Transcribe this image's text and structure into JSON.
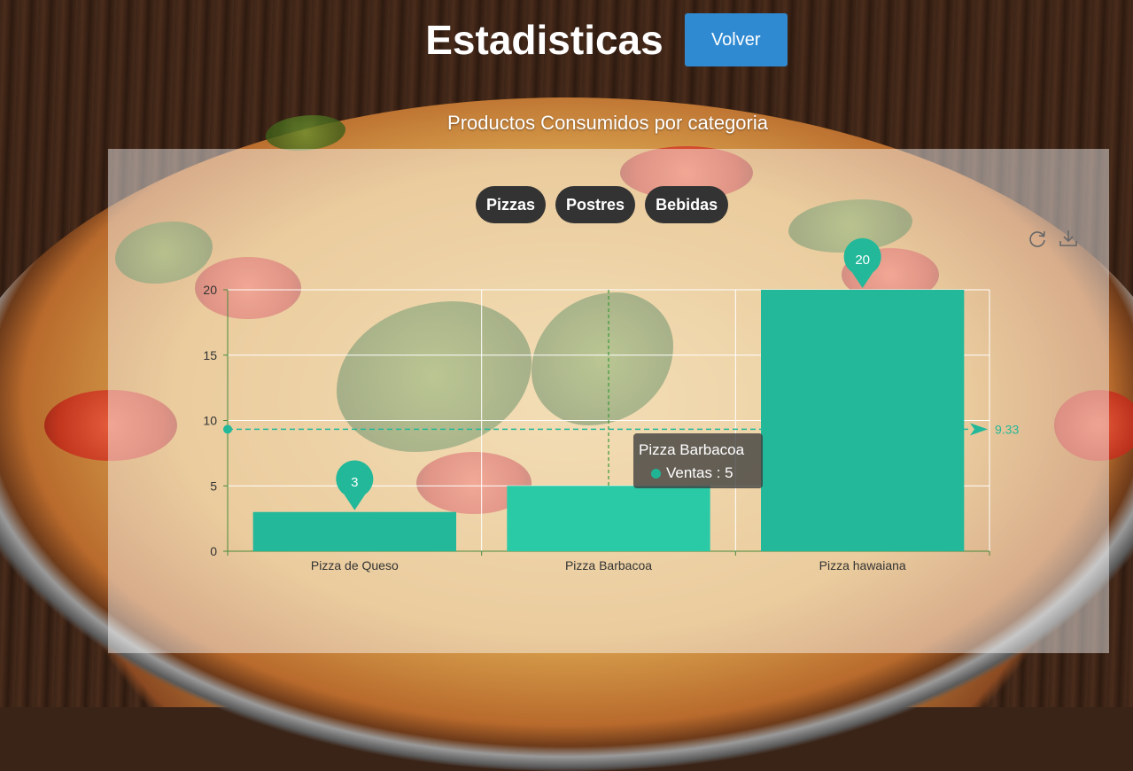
{
  "header": {
    "title": "Estadisticas",
    "back_label": "Volver",
    "subtitle": "Productos Consumidos por categoria"
  },
  "filters": [
    "Pizzas",
    "Postres",
    "Bebidas"
  ],
  "toolbox": {
    "refresh_icon": "refresh-icon",
    "download_icon": "download-icon"
  },
  "colors": {
    "bar": "#22b899",
    "bar_highlight": "#2bcaa6",
    "accent": "#2f8ad2"
  },
  "tooltip": {
    "title": "Pizza Barbacoa",
    "text": "Ventas : 5"
  },
  "chart_data": {
    "type": "bar",
    "categories": [
      "Pizza de Queso",
      "Pizza Barbacoa",
      "Pizza hawaiana"
    ],
    "series": [
      {
        "name": "Ventas",
        "values": [
          3,
          5,
          20
        ]
      }
    ],
    "ylim": [
      0,
      20
    ],
    "yticks": [
      0,
      5,
      10,
      15,
      20
    ],
    "mark_points": [
      {
        "category": "Pizza de Queso",
        "value": 3,
        "label": "3"
      },
      {
        "category": "Pizza hawaiana",
        "value": 20,
        "label": "20"
      }
    ],
    "mark_line": {
      "type": "average",
      "value": 9.33,
      "label": "9.33"
    },
    "highlighted_category": "Pizza Barbacoa",
    "grid": true
  }
}
